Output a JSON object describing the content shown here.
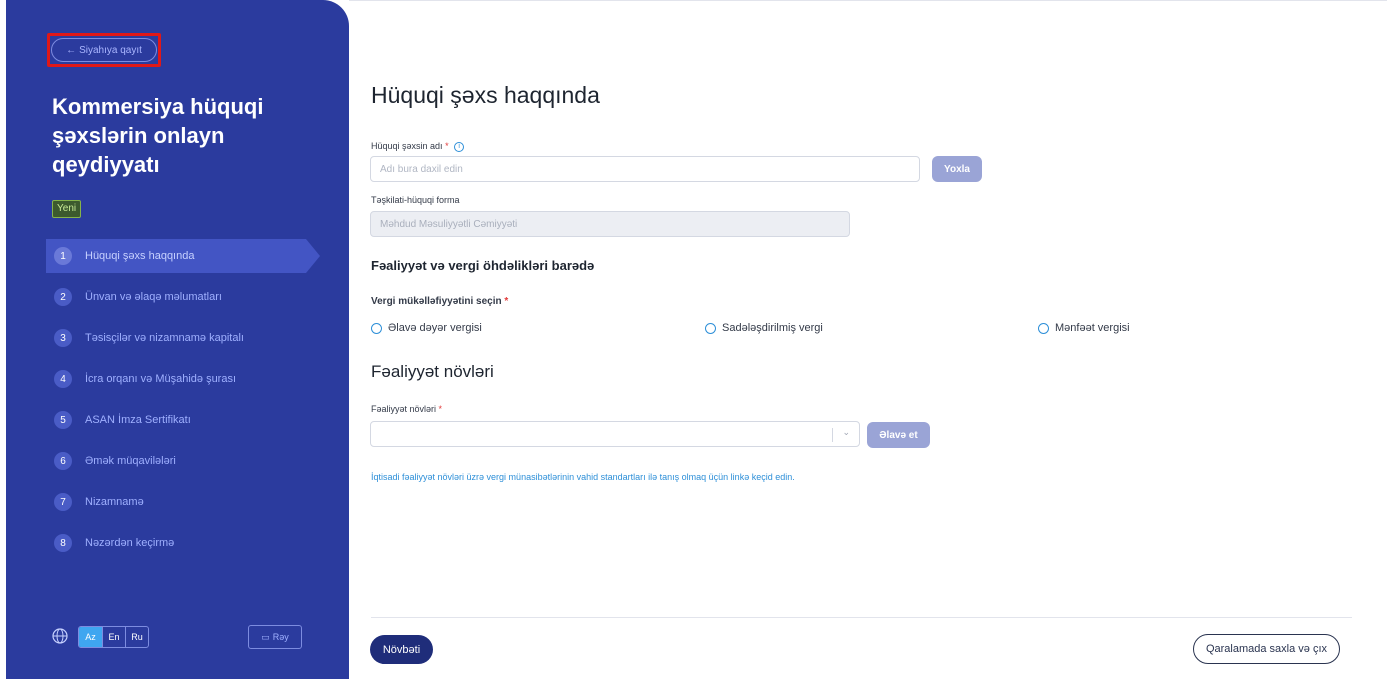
{
  "sidebar": {
    "back_label": "Siyahıya qayıt",
    "title": "Kommersiya hüquqi şəxslərin onlayn qeydiyyatı",
    "badge": "Yeni",
    "steps": [
      {
        "num": "1",
        "label": "Hüquqi şəxs haqqında",
        "active": true
      },
      {
        "num": "2",
        "label": "Ünvan və əlaqə məlumatları"
      },
      {
        "num": "3",
        "label": "Təsisçilər və nizamnamə kapitalı"
      },
      {
        "num": "4",
        "label": "İcra orqanı və Müşahidə şurası"
      },
      {
        "num": "5",
        "label": "ASAN İmza Sertifikatı"
      },
      {
        "num": "6",
        "label": "Əmək müqavilələri"
      },
      {
        "num": "7",
        "label": "Nizamnamə"
      },
      {
        "num": "8",
        "label": "Nəzərdən keçirmə"
      }
    ],
    "languages": [
      "Az",
      "En",
      "Ru"
    ],
    "active_language": "Az",
    "feedback_label": "Rəy"
  },
  "main": {
    "title": "Hüquqi şəxs haqqında",
    "name_field": {
      "label": "Hüquqi şəxsin adı",
      "required_mark": "*",
      "placeholder": "Adı bura daxil edin",
      "check_button": "Yoxla"
    },
    "form_field": {
      "label": "Təşkilati-hüquqi forma",
      "value": "Məhdud Məsuliyyətli Cəmiyyəti"
    },
    "tax_section": {
      "heading": "Fəaliyyət və vergi öhdəlikləri barədə",
      "question": "Vergi mükəlləfiyyətini seçin",
      "required_mark": "*",
      "options": [
        "Əlavə dəyər vergisi",
        "Sadələşdirilmiş vergi",
        "Mənfəət vergisi"
      ]
    },
    "activity_section": {
      "heading": "Fəaliyyət növləri",
      "field_label": "Fəaliyyət növləri",
      "required_mark": "*",
      "add_button": "Əlavə et",
      "link_note": "İqtisadi fəaliyyət növləri üzrə vergi münasibətlərinin vahid standartları ilə tanış olmaq üçün linkə keçid edin."
    }
  },
  "footer": {
    "next_label": "Növbəti",
    "save_exit_label": "Qaralamada saxla və çıx"
  },
  "colors": {
    "sidebar_bg": "#2b3b9e",
    "accent": "#2d8fd8",
    "primary_button": "#1f2d7a",
    "highlight_frame": "#e01818"
  }
}
